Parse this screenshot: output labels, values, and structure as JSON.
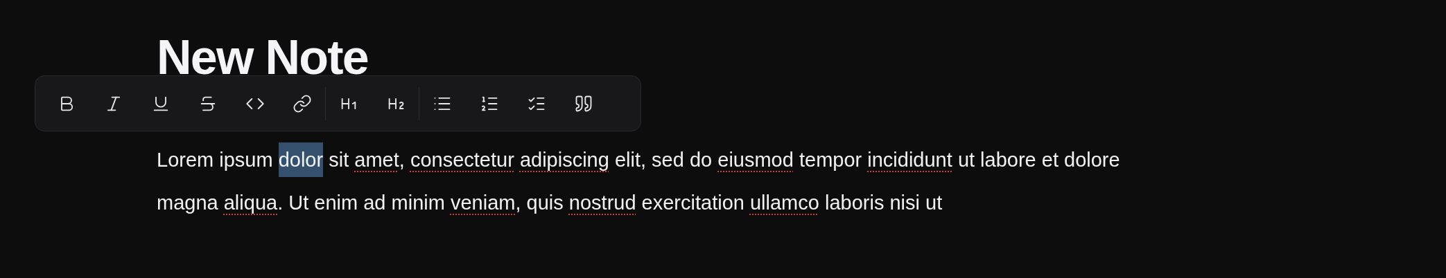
{
  "title": "New Note",
  "paragraph": {
    "lines": [
      [
        {
          "text": "Lorem ipsum ",
          "misspelled": false,
          "selected": false
        },
        {
          "text": "dolor",
          "misspelled": false,
          "selected": true
        },
        {
          "text": " sit ",
          "misspelled": false,
          "selected": false
        },
        {
          "text": "amet",
          "misspelled": true,
          "selected": false
        },
        {
          "text": ", ",
          "misspelled": false,
          "selected": false
        },
        {
          "text": "consectetur",
          "misspelled": true,
          "selected": false
        },
        {
          "text": " adipiscing",
          "misspelled": true,
          "selected": false
        },
        {
          "text": " elit, sed do ",
          "misspelled": false,
          "selected": false
        },
        {
          "text": "eiusmod",
          "misspelled": true,
          "selected": false
        },
        {
          "text": " tempor ",
          "misspelled": false,
          "selected": false
        },
        {
          "text": "incididunt",
          "misspelled": true,
          "selected": false
        },
        {
          "text": " ut labore et dolore",
          "misspelled": false,
          "selected": false
        }
      ],
      [
        {
          "text": "magna ",
          "misspelled": false,
          "selected": false
        },
        {
          "text": "aliqua",
          "misspelled": true,
          "selected": false
        },
        {
          "text": ". Ut enim ad minim ",
          "misspelled": false,
          "selected": false
        },
        {
          "text": "veniam",
          "misspelled": true,
          "selected": false
        },
        {
          "text": ", quis ",
          "misspelled": false,
          "selected": false
        },
        {
          "text": "nostrud",
          "misspelled": true,
          "selected": false
        },
        {
          "text": " exercitation ",
          "misspelled": false,
          "selected": false
        },
        {
          "text": "ullamco",
          "misspelled": true,
          "selected": false
        },
        {
          "text": " laboris nisi ut",
          "misspelled": false,
          "selected": false
        }
      ]
    ]
  }
}
